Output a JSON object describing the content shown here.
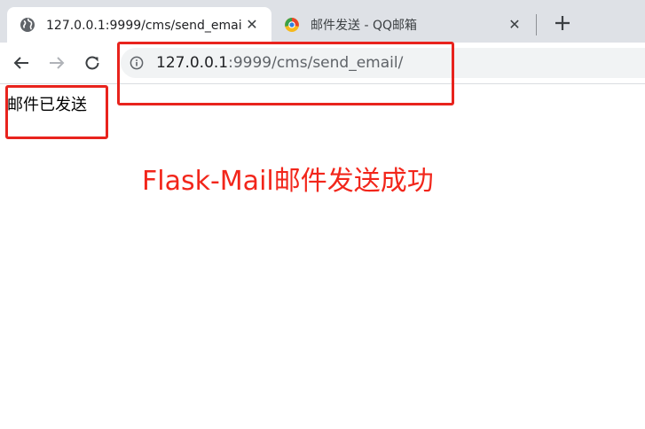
{
  "tabs": [
    {
      "title": "127.0.0.1:9999/cms/send_email/",
      "favicon": "globe-icon",
      "active": true,
      "close": "✕"
    },
    {
      "title": "邮件发送 - QQ邮箱",
      "favicon": "qqmail-icon",
      "active": false,
      "close": "✕"
    }
  ],
  "new_tab_label": "+",
  "toolbar": {
    "back": "back-arrow-icon",
    "forward": "forward-arrow-icon",
    "reload": "reload-icon",
    "site_info": "info-icon"
  },
  "address": {
    "host": "127.0.0.1",
    "rest": ":9999/cms/send_email/"
  },
  "page": {
    "message": "邮件已发送",
    "caption": "Flask-Mail邮件发送成功"
  },
  "colors": {
    "tabstrip": "#dee1e6",
    "annotation": "#e8231d",
    "caption": "#f2261b"
  }
}
